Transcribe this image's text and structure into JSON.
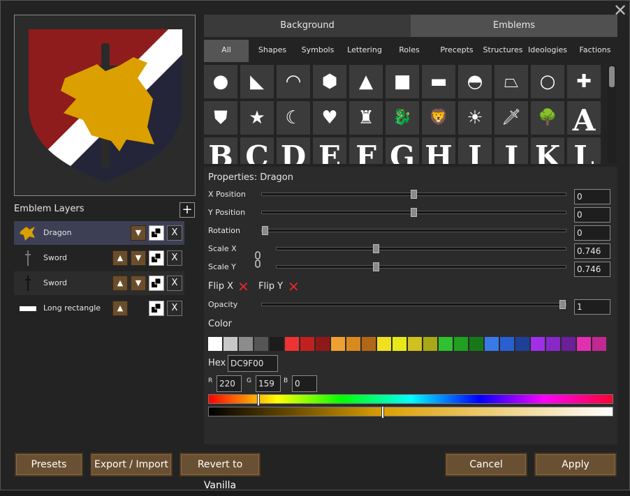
{
  "window": {
    "close_label": "✕"
  },
  "preview": {
    "colors": {
      "field_red": "#8e1c1c",
      "field_navy": "#25253a",
      "band": "#ffffff",
      "dragon": "#dc9f00",
      "sword": "#2a2a2a"
    }
  },
  "layers": {
    "title": "Emblem Layers",
    "add_label": "+",
    "items": [
      {
        "name": "Dragon",
        "icon": "dragon-icon"
      },
      {
        "name": "Sword",
        "icon": "sword-icon"
      },
      {
        "name": "Sword",
        "icon": "sword-icon"
      },
      {
        "name": "Long rectangle",
        "icon": "rectangle-icon"
      }
    ],
    "up_label": "▲",
    "down_label": "▼",
    "delete_label": "X"
  },
  "tabs": {
    "background": "Background",
    "emblems": "Emblems"
  },
  "categories": [
    "All",
    "Shapes",
    "Symbols",
    "Lettering",
    "Roles",
    "Precepts",
    "Structures",
    "Ideologies",
    "Factions"
  ],
  "emblem_grid": {
    "row1": [
      "●",
      "◣",
      "◠",
      "⬢",
      "▲",
      "■",
      "▬",
      "◓",
      "⏢",
      "○",
      "✚"
    ],
    "row2": [
      "⛊",
      "★",
      "☾",
      "♥",
      "♜",
      "🐉",
      "🦁",
      "☀",
      "🗡",
      "🌳",
      "A"
    ],
    "row3": [
      "B",
      "C",
      "D",
      "E",
      "F",
      "G",
      "H",
      "I",
      "J",
      "K",
      "L"
    ]
  },
  "properties": {
    "title": "Properties: Dragon",
    "x_label": "X Position",
    "x_value": "0",
    "x_level": 0.5,
    "y_label": "Y Position",
    "y_value": "0",
    "y_level": 0.5,
    "rot_label": "Rotation",
    "rot_value": "0",
    "rot_level": 0.0,
    "sx_label": "Scale X",
    "sx_value": "0.746",
    "sx_level": 0.34,
    "sy_label": "Scale Y",
    "sy_value": "0.746",
    "sy_level": 0.34,
    "flipx_label": "Flip X",
    "flipy_label": "Flip Y",
    "opacity_label": "Opacity",
    "opacity_value": "1",
    "opacity_level": 1.0,
    "color_label": "Color",
    "palette": [
      "#ffffff",
      "#c8c8c8",
      "#8c8c8c",
      "#555555",
      "#1c1c1c",
      "#ee3333",
      "#c02020",
      "#901818",
      "#f0a030",
      "#d88a20",
      "#b06818",
      "#f0e020",
      "#e8e818",
      "#d0c020",
      "#a8a818",
      "#30c030",
      "#20a020",
      "#187818",
      "#3a7ae8",
      "#2860d0",
      "#1e4098",
      "#a030e8",
      "#8828c8",
      "#6a2098",
      "#e030b0",
      "#c02890"
    ],
    "hex_label": "Hex",
    "hex_value": "DC9F00",
    "r_label": "R",
    "r_value": "220",
    "g_label": "G",
    "g_value": "159",
    "b_label": "B",
    "b_value": "0",
    "hue_level": 0.12,
    "shade_level": 0.43
  },
  "buttons": {
    "presets": "Presets",
    "export_import": "Export / Import",
    "revert": "Revert to Vanilla",
    "cancel": "Cancel",
    "apply": "Apply"
  }
}
